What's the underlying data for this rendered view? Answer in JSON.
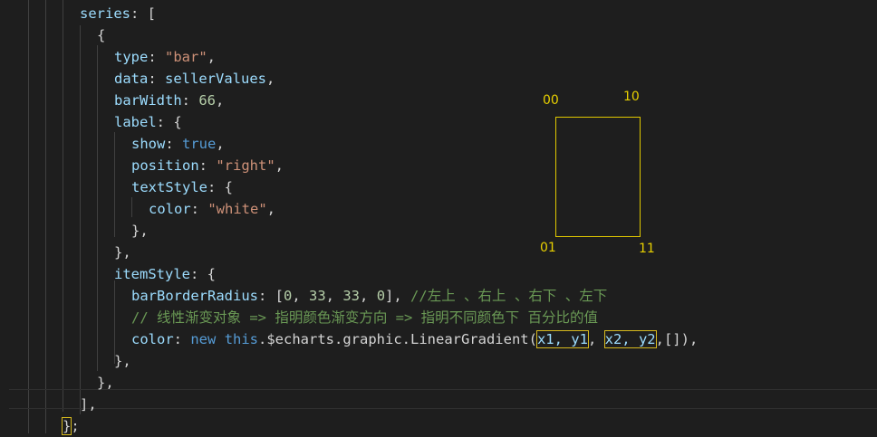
{
  "code": {
    "series_key": "series",
    "type_key": "type",
    "type_value": "\"bar\"",
    "data_key": "data",
    "data_value": "sellerValues",
    "barwidth_key": "barWidth",
    "barwidth_value": "66",
    "label_key": "label",
    "show_key": "show",
    "show_value": "true",
    "position_key": "position",
    "position_value": "\"right\"",
    "textstyle_key": "textStyle",
    "color_key": "color",
    "color_value": "\"white\"",
    "itemstyle_key": "itemStyle",
    "radius_key": "barBorderRadius",
    "radius_values": [
      "0",
      "33",
      "33",
      "0"
    ],
    "radius_comment": "//左上 、右上 、右下 、左下",
    "gradient_comment": "// 线性渐变对象 => 指明颜色渐变方向 => 指明不同颜色下 百分比的值",
    "gradient_color_key": "color",
    "new_kw": "new",
    "this_kw": "this",
    "gradient_call": ".$echarts.graphic.LinearGradient(",
    "arg_x1y1": "x1, y1",
    "arg_x2y2": "x2, y2",
    "arg_rest": ",[]),"
  },
  "annotation": {
    "top_left": "00",
    "top_right": "10",
    "bottom_left": "01",
    "bottom_right": "11"
  },
  "colors": {
    "background": "#1e1e1e",
    "property": "#9cdcfe",
    "string": "#ce9178",
    "number": "#b5cea8",
    "keyword": "#569cd6",
    "comment": "#6a9955",
    "annotation": "#e0c800"
  }
}
